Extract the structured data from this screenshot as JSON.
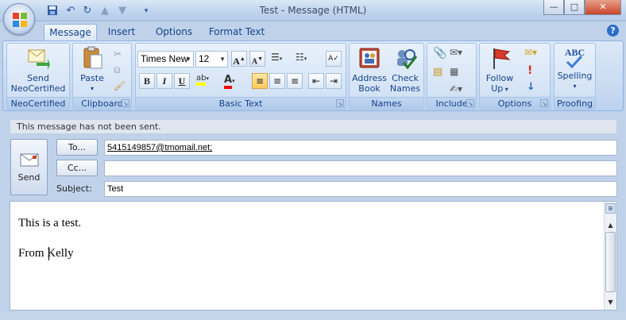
{
  "window": {
    "title": "Test - Message (HTML)",
    "controls": {
      "minimize": "—",
      "maximize": "□",
      "close": "✕"
    }
  },
  "quick_access": {
    "save_icon": "save-icon",
    "undo_icon": "undo-icon",
    "redo_icon": "redo-icon",
    "prev_icon": "up-arrow-icon",
    "next_icon": "down-arrow-icon",
    "customize_icon": "dropdown-icon"
  },
  "tabs": [
    {
      "label": "Message",
      "active": true
    },
    {
      "label": "Insert"
    },
    {
      "label": "Options"
    },
    {
      "label": "Format Text"
    }
  ],
  "ribbon": {
    "neocertified": {
      "group_label": "NeoCertified",
      "send_label_line1": "Send",
      "send_label_line2": "NeoCertified"
    },
    "clipboard": {
      "group_label": "Clipboard",
      "paste_label": "Paste"
    },
    "basic_text": {
      "group_label": "Basic Text",
      "font": "Times New",
      "size": "12",
      "bold": "B",
      "italic": "I",
      "underline": "U",
      "highlight": "ab",
      "font_color": "A",
      "grow": "A",
      "shrink": "A"
    },
    "names": {
      "group_label": "Names",
      "address_book_line1": "Address",
      "address_book_line2": "Book",
      "check_names_line1": "Check",
      "check_names_line2": "Names"
    },
    "include": {
      "group_label": "Include"
    },
    "options": {
      "group_label": "Options",
      "follow_up_line1": "Follow",
      "follow_up_line2": "Up"
    },
    "proofing": {
      "group_label": "Proofing",
      "spelling_label": "Spelling",
      "abc": "ABC"
    }
  },
  "message": {
    "info": "This message has not been sent.",
    "send_label": "Send",
    "to_button": "To...",
    "cc_button": "Cc...",
    "subject_label": "Subject:",
    "to_value": "5415149857@tmomail.net;",
    "cc_value": "",
    "subject_value": "Test",
    "body_line1": "This is a test.",
    "body_line2": "From Kelly"
  },
  "colors": {
    "accent": "#15428b",
    "ribbon_bg": "#c7daf1",
    "highlight_yellow": "#ffff00",
    "font_red": "#ff0000"
  }
}
